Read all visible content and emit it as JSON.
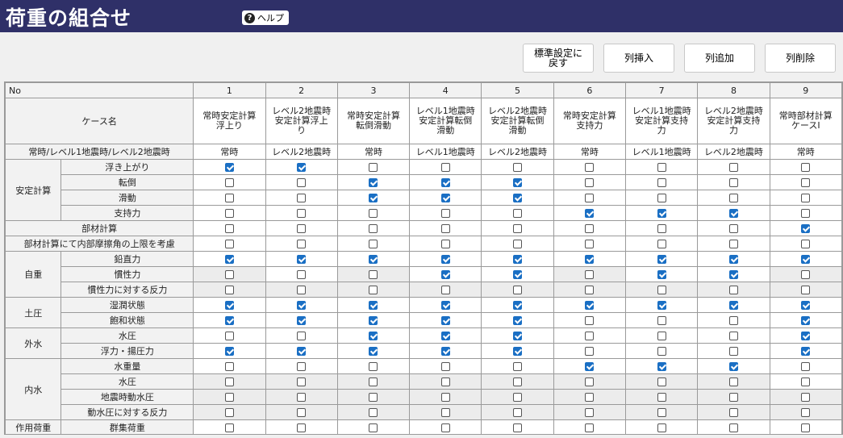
{
  "page": {
    "title": "荷重の組合せ",
    "help_label": "ヘルプ"
  },
  "toolbar": {
    "reset_label": "標準設定に\n戻す",
    "insert_label": "列挿入",
    "add_label": "列追加",
    "delete_label": "列削除"
  },
  "grid": {
    "no_label": "No",
    "case_name_label": "ケース名",
    "mode_label": "常時/レベル1地震時/レベル2地震時",
    "columns": [
      {
        "no": "1",
        "name": "常時安定計算\n浮上り",
        "mode": "常時"
      },
      {
        "no": "2",
        "name": "レベル2地震時\n安定計算浮上\nり",
        "mode": "レベル2地震時"
      },
      {
        "no": "3",
        "name": "常時安定計算\n転倒滑動",
        "mode": "常時"
      },
      {
        "no": "4",
        "name": "レベル1地震時\n安定計算転倒\n滑動",
        "mode": "レベル1地震時"
      },
      {
        "no": "5",
        "name": "レベル2地震時\n安定計算転倒\n滑動",
        "mode": "レベル2地震時"
      },
      {
        "no": "6",
        "name": "常時安定計算\n支持力",
        "mode": "常時"
      },
      {
        "no": "7",
        "name": "レベル1地震時\n安定計算支持\n力",
        "mode": "レベル1地震時"
      },
      {
        "no": "8",
        "name": "レベル2地震時\n安定計算支持\n力",
        "mode": "レベル2地震時"
      },
      {
        "no": "9",
        "name": "常時部材計算\nケースⅠ",
        "mode": "常時"
      }
    ],
    "rows": [
      {
        "group": "安定計算",
        "item": "浮き上がり",
        "checks": [
          1,
          1,
          0,
          0,
          0,
          0,
          0,
          0,
          0
        ],
        "shaded": []
      },
      {
        "group": "安定計算",
        "item": "転倒",
        "checks": [
          0,
          0,
          1,
          1,
          1,
          0,
          0,
          0,
          0
        ],
        "shaded": []
      },
      {
        "group": "安定計算",
        "item": "滑動",
        "checks": [
          0,
          0,
          1,
          1,
          1,
          0,
          0,
          0,
          0
        ],
        "shaded": []
      },
      {
        "group": "安定計算",
        "item": "支持力",
        "checks": [
          0,
          0,
          0,
          0,
          0,
          1,
          1,
          1,
          0
        ],
        "shaded": []
      },
      {
        "group": "",
        "item": "部材計算",
        "checks": [
          0,
          0,
          0,
          0,
          0,
          0,
          0,
          0,
          1
        ],
        "shaded": []
      },
      {
        "group": "",
        "item": "部材計算にて内部摩擦角の上限を考慮",
        "checks": [
          0,
          0,
          0,
          0,
          0,
          0,
          0,
          0,
          0
        ],
        "shaded": []
      },
      {
        "group": "自重",
        "item": "鉛直力",
        "checks": [
          1,
          1,
          1,
          1,
          1,
          1,
          1,
          1,
          1
        ],
        "shaded": []
      },
      {
        "group": "自重",
        "item": "慣性力",
        "checks": [
          0,
          0,
          0,
          1,
          1,
          0,
          1,
          1,
          0
        ],
        "shaded": [
          0,
          2,
          5,
          8
        ]
      },
      {
        "group": "自重",
        "item": "慣性力に対する反力",
        "checks": [
          0,
          0,
          0,
          0,
          0,
          0,
          0,
          0,
          0
        ],
        "shaded": [
          0,
          1,
          2,
          3,
          4,
          5,
          6,
          7,
          8
        ]
      },
      {
        "group": "土圧",
        "item": "湿潤状態",
        "checks": [
          1,
          1,
          1,
          1,
          1,
          1,
          1,
          1,
          1
        ],
        "shaded": []
      },
      {
        "group": "土圧",
        "item": "飽和状態",
        "checks": [
          1,
          1,
          1,
          1,
          1,
          0,
          0,
          0,
          1
        ],
        "shaded": []
      },
      {
        "group": "外水",
        "item": "水圧",
        "checks": [
          0,
          0,
          1,
          1,
          1,
          0,
          0,
          0,
          1
        ],
        "shaded": []
      },
      {
        "group": "外水",
        "item": "浮力・揚圧力",
        "checks": [
          1,
          1,
          1,
          1,
          1,
          0,
          0,
          0,
          1
        ],
        "shaded": []
      },
      {
        "group": "内水",
        "item": "水重量",
        "checks": [
          0,
          0,
          0,
          0,
          0,
          1,
          1,
          1,
          0
        ],
        "shaded": []
      },
      {
        "group": "内水",
        "item": "水圧",
        "checks": [
          0,
          0,
          0,
          0,
          0,
          0,
          0,
          0,
          0
        ],
        "shaded": [
          0,
          1,
          2,
          3,
          4,
          5,
          6,
          7
        ]
      },
      {
        "group": "内水",
        "item": "地震時動水圧",
        "checks": [
          0,
          0,
          0,
          0,
          0,
          0,
          0,
          0,
          0
        ],
        "shaded": [
          0,
          1,
          2,
          3,
          4,
          5,
          6,
          7,
          8
        ]
      },
      {
        "group": "内水",
        "item": "動水圧に対する反力",
        "checks": [
          0,
          0,
          0,
          0,
          0,
          0,
          0,
          0,
          0
        ],
        "shaded": [
          0,
          1,
          2,
          3,
          4,
          5,
          6,
          7,
          8
        ]
      },
      {
        "group": "作用荷重",
        "item": "群集荷重",
        "checks": [
          0,
          0,
          0,
          0,
          0,
          0,
          0,
          0,
          0
        ],
        "shaded": []
      }
    ]
  },
  "colors": {
    "titlebar": "#2f3068",
    "check": "#1a6fc4"
  }
}
